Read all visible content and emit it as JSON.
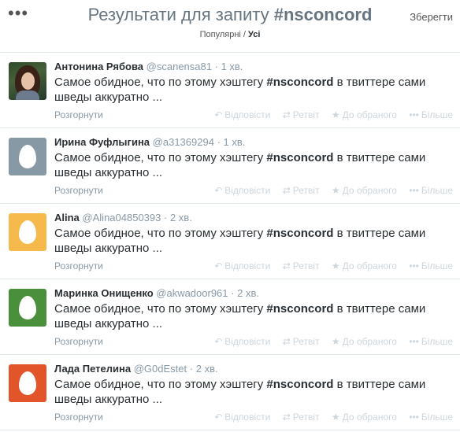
{
  "header": {
    "title_prefix": "Результати для запиту",
    "query": "#nsconcord",
    "save_label": "Зберегти",
    "tab_top": "Популярні",
    "tab_sep": " / ",
    "tab_all": "Усі"
  },
  "tweets": [
    {
      "name": "Антонина Рябова",
      "handle": "@scanensa81",
      "time": "1 хв.",
      "avatar": "photo",
      "text_before": "Самое обидное, что по этому хэштегу ",
      "hashtag": "#nsconcord",
      "text_after": " в твиттере сами шведы аккуратно ..."
    },
    {
      "name": "Ирина Фуфлыгина",
      "handle": "@a31369294",
      "time": "1 хв.",
      "avatar": "egg",
      "text_before": "Самое обидное, что по этому хэштегу ",
      "hashtag": "#nsconcord",
      "text_after": " в твиттере сами шведы аккуратно ..."
    },
    {
      "name": "Alina",
      "handle": "@Alina04850393",
      "time": "2 хв.",
      "avatar": "egg",
      "text_before": "Самое обидное, что по этому хэштегу ",
      "hashtag": "#nsconcord",
      "text_after": " в твиттере сами шведы аккуратно ..."
    },
    {
      "name": "Маринка Онищенко",
      "handle": "@akwadoor961",
      "time": "2 хв.",
      "avatar": "egg",
      "text_before": "Самое обидное, что по этому хэштегу ",
      "hashtag": "#nsconcord",
      "text_after": " в твиттере сами шведы аккуратно ..."
    },
    {
      "name": "Лада Петелина",
      "handle": "@G0dEstet",
      "time": "2 хв.",
      "avatar": "egg",
      "text_before": "Самое обидное, что по этому хэштегу ",
      "hashtag": "#nsconcord",
      "text_after": " в твиттере сами шведы аккуратно ..."
    }
  ],
  "avatar_colors": [
    "#2e4a2a",
    "#8899a6",
    "#f5b94c",
    "#4a8f3c",
    "#e2552b"
  ],
  "actions": {
    "expand": "Розгорнути",
    "reply": "Відповісти",
    "retweet": "Ретвіт",
    "favorite": "До обраного",
    "more": "Більше"
  },
  "icons": {
    "more_dots": "more-dots-icon",
    "reply": "reply-icon",
    "retweet": "retweet-icon",
    "favorite": "star-icon",
    "more": "more-icon",
    "egg": "default-egg-avatar-icon"
  }
}
